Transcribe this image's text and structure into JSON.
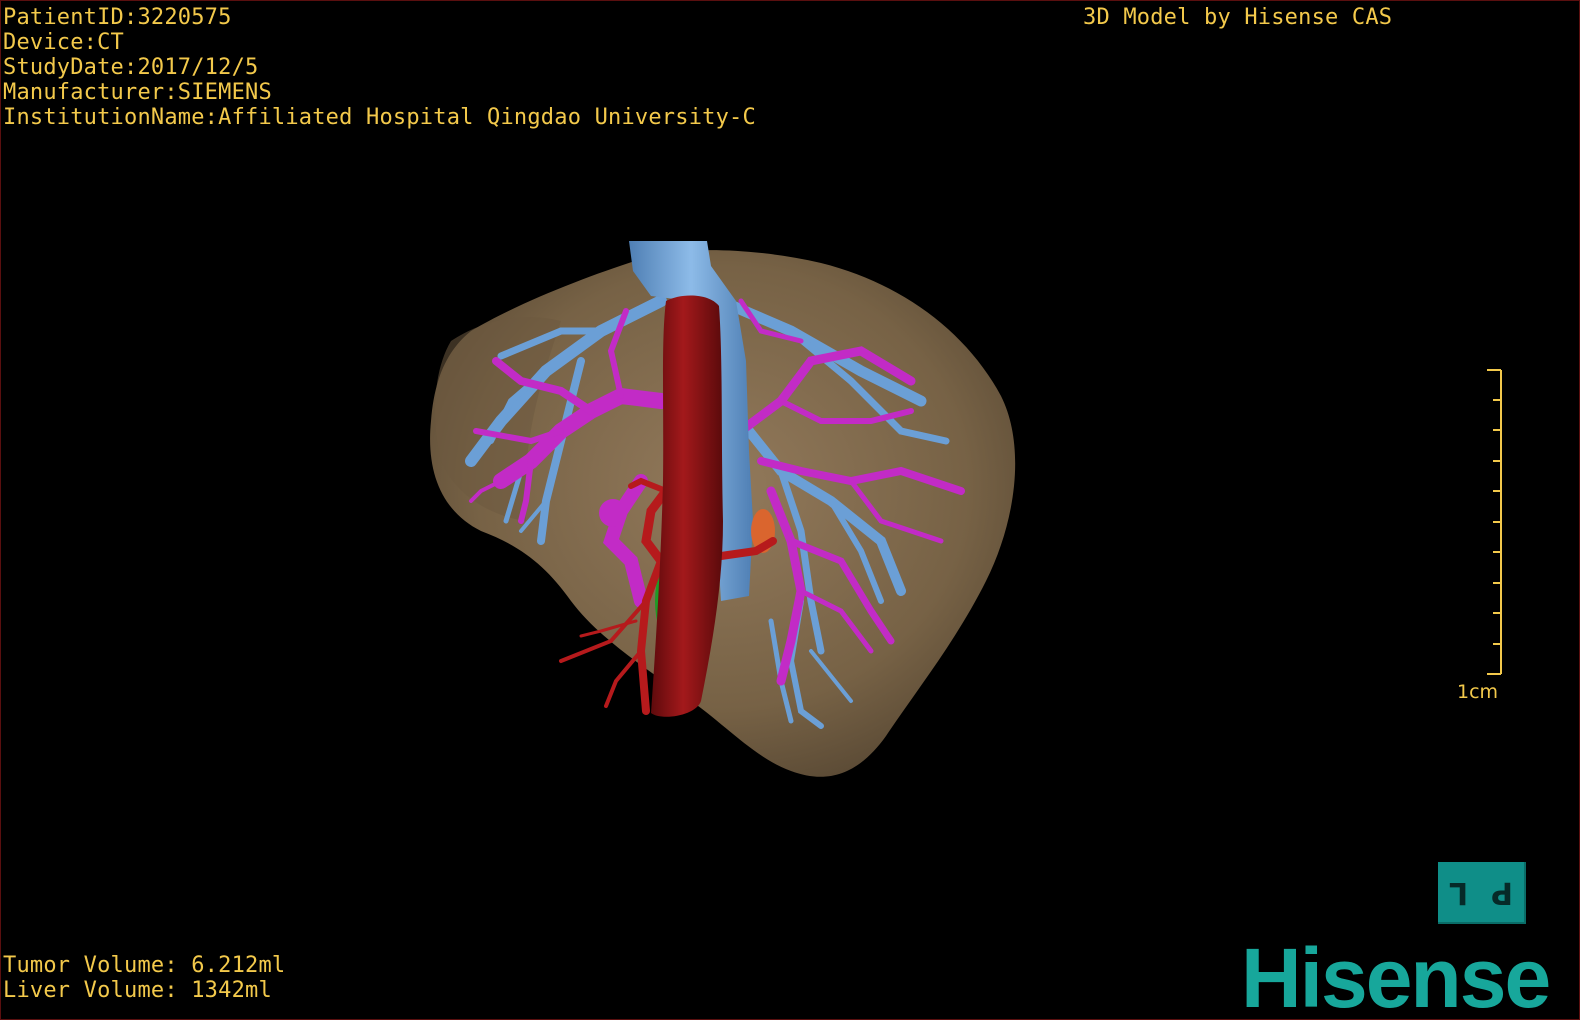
{
  "patient_info": {
    "patient_id": "PatientID:3220575",
    "device": "Device:CT",
    "study_date": "StudyDate:2017/12/5",
    "manufacturer": "Manufacturer:SIEMENS",
    "institution": "InstitutionName:Affiliated Hospital Qingdao University-C"
  },
  "model_credit": "3D Model by Hisense CAS",
  "volumes": {
    "tumor": "Tumor Volume: 6.212ml",
    "liver": "Liver Volume: 1342ml"
  },
  "scale": {
    "label": "1cm"
  },
  "orientation_cube": {
    "left_face": "L",
    "right_face": "P"
  },
  "brand": "Hisense",
  "colors": {
    "overlay_text": "#f3c94b",
    "liver": "#8a7250",
    "hepatic_vein": "#6b9fd6",
    "portal_vein": "#c22bc6",
    "vena_cava_aorta": "#8e1416",
    "artery": "#b61a1c",
    "tumor": "#e2642a",
    "gallbladder": "#1f9a25",
    "brand": "#17a79b"
  }
}
